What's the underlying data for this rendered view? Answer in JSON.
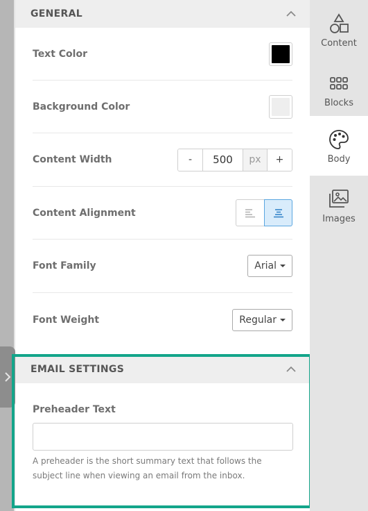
{
  "sidebar": {
    "items": [
      {
        "label": "Content",
        "icon": "shapes-icon",
        "active": false
      },
      {
        "label": "Blocks",
        "icon": "grid-dots-icon",
        "active": false
      },
      {
        "label": "Body",
        "icon": "palette-icon",
        "active": true
      },
      {
        "label": "Images",
        "icon": "images-icon",
        "active": false
      }
    ]
  },
  "general": {
    "title": "GENERAL",
    "text_color_label": "Text Color",
    "text_color_value": "#000000",
    "background_color_label": "Background Color",
    "background_color_value": "#eeeeee",
    "content_width_label": "Content Width",
    "content_width_decrement": "-",
    "content_width_value": "500",
    "content_width_unit": "px",
    "content_width_increment": "+",
    "content_alignment_label": "Content Alignment",
    "content_alignment_selected": "center",
    "font_family_label": "Font Family",
    "font_family_value": "Arial",
    "font_weight_label": "Font Weight",
    "font_weight_value": "Regular"
  },
  "email_settings": {
    "title": "EMAIL SETTINGS",
    "preheader_label": "Preheader Text",
    "preheader_value": "",
    "preheader_help": "A preheader is the short summary text that follows the subject line when viewing an email from the inbox."
  },
  "colors": {
    "highlight": "#13a58a",
    "active_alignment": "#d9ecfb",
    "sidebar_bg": "#e4e4e4"
  }
}
